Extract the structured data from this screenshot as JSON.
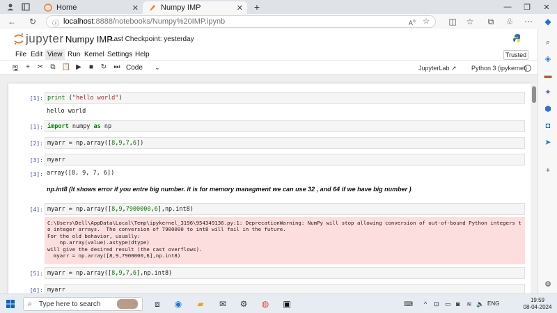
{
  "browser": {
    "tabs": [
      {
        "label": "Home"
      },
      {
        "label": "Numpy IMP"
      }
    ],
    "address": {
      "host": "localhost",
      "path": ":8888/notebooks/Numpy%20IMP.ipynb"
    },
    "new_tab": "+"
  },
  "jupyter": {
    "logo_text": "jupyter",
    "notebook_name": "Numpy IMP",
    "checkpoint": "Last Checkpoint: yesterday",
    "menu": [
      "File",
      "Edit",
      "View",
      "Run",
      "Kernel",
      "Settings",
      "Help"
    ],
    "trusted": "Trusted",
    "cell_type": "Code",
    "jupyterlab_link": "JupyterLab",
    "kernel_name": "Python 3 (ipykernel)"
  },
  "cells": {
    "c1": {
      "prompt": "[1]:",
      "output": "hello world"
    },
    "c2": {
      "prompt": "[1]:"
    },
    "c3": {
      "prompt": "[2]:"
    },
    "c4": {
      "prompt": "[3]:",
      "output_prompt": "[3]:",
      "output": "array([8, 9, 7, 6])"
    },
    "md": "np.int8 (It shows error if you entre big number. it is for memory managment we can use 32 , and 64 if we have big number )",
    "c5": {
      "prompt": "[4]:",
      "warning": "C:\\Users\\Dell\\AppData\\Local\\Temp\\ipykernel_3196\\954349136.py:1: DeprecationWarning: NumPy will stop allowing conversion of out-of-bound Python integers t\no integer arrays.  The conversion of 7900000 to int8 will fail in the future.\nFor the old behavior, usually:\n    np.array(value).astype(dtype)\nwill give the desired result (the cast overflows).\n  myarr = np.array([8,9,7900000,6],np.int8)"
    },
    "c6": {
      "prompt": "[5]:"
    },
    "c7": {
      "prompt": "[6]:"
    }
  },
  "taskbar": {
    "search_placeholder": "Type here to search",
    "lang": "ENG",
    "time": "19:59",
    "date": "08-04-2024"
  }
}
